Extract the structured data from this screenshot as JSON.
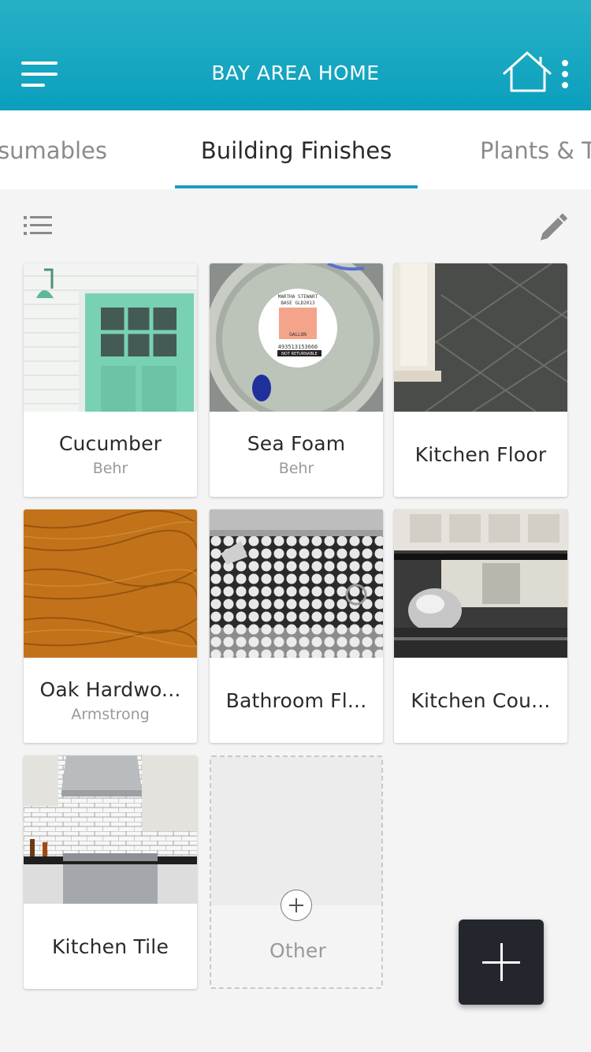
{
  "header": {
    "title": "BAY AREA HOME",
    "icons": [
      "menu-icon",
      "home-icon",
      "more-vert-icon"
    ]
  },
  "tabs": [
    {
      "label": "sumables",
      "active": false
    },
    {
      "label": "Building Finishes",
      "active": true
    },
    {
      "label": "Plants & T",
      "active": false
    }
  ],
  "toolbar": {
    "icons": [
      "list-view-icon",
      "edit-pencil-icon"
    ]
  },
  "items": [
    {
      "name": "Cucumber",
      "brand": "Behr"
    },
    {
      "name": "Sea Foam",
      "brand": "Behr"
    },
    {
      "name": "Kitchen Floor",
      "brand": ""
    },
    {
      "name": "Oak Hardwo...",
      "brand": "Armstrong"
    },
    {
      "name": "Bathroom Fl...",
      "brand": ""
    },
    {
      "name": "Kitchen Cou...",
      "brand": ""
    },
    {
      "name": "Kitchen Tile",
      "brand": ""
    }
  ],
  "paint_label": {
    "lines": [
      "MARTHA STEWART",
      "BASE GLD2013",
      "GALLON",
      "493513153666",
      "NOT RETURNABLE"
    ]
  },
  "add_other": {
    "label": "Other"
  },
  "fab": {
    "icon": "plus-icon"
  },
  "colors": {
    "app_bar": "#0b9fbd",
    "tab_indicator": "#1a9ec2",
    "fab": "#23272d",
    "door_green": "#79d1b4"
  }
}
